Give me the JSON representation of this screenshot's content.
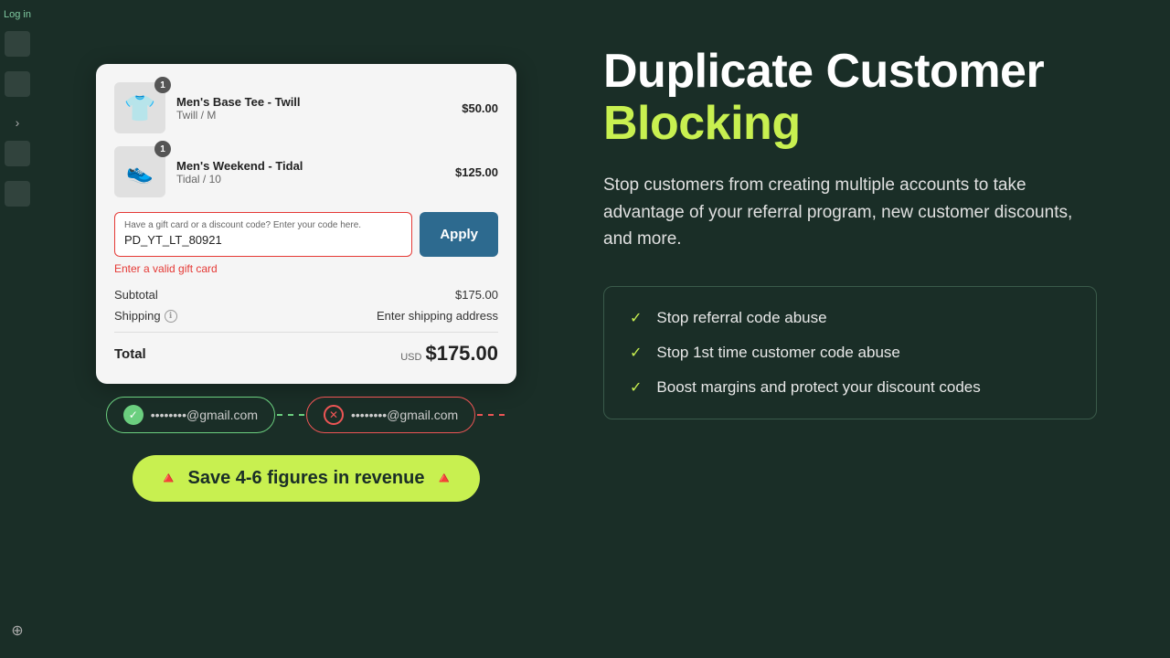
{
  "left": {
    "sidebar": {
      "login_label": "Log in"
    },
    "product1": {
      "name": "Men's Base Tee - Twill",
      "variant": "Twill / M",
      "price": "$50.00",
      "badge": "1",
      "emoji": "👕"
    },
    "product2": {
      "name": "Men's Weekend - Tidal",
      "variant": "Tidal / 10",
      "price": "$125.00",
      "badge": "1",
      "emoji": "👟"
    },
    "discount": {
      "placeholder": "Have a gift card or a discount code? Enter your code here.",
      "value": "PD_YT_LT_80921",
      "error": "Enter a valid gift card",
      "apply_label": "Apply"
    },
    "subtotal_label": "Subtotal",
    "subtotal_value": "$175.00",
    "shipping_label": "Shipping",
    "shipping_value": "Enter shipping address",
    "total_label": "Total",
    "total_currency": "USD",
    "total_amount": "$175.00",
    "email1": {
      "text": "@gmail.com"
    },
    "email2": {
      "text": "@gmail.com"
    },
    "cta": {
      "label": "Save 4-6 figures in revenue",
      "icon": "🔺"
    }
  },
  "right": {
    "headline_line1": "Duplicate Customer",
    "headline_line2": "Blocking",
    "description": "Stop customers from creating multiple accounts to take advantage of your referral program, new customer discounts, and more.",
    "features": [
      {
        "text": "Stop referral code abuse"
      },
      {
        "text": "Stop 1st time customer code abuse"
      },
      {
        "text": "Boost margins and protect your discount codes"
      }
    ]
  }
}
